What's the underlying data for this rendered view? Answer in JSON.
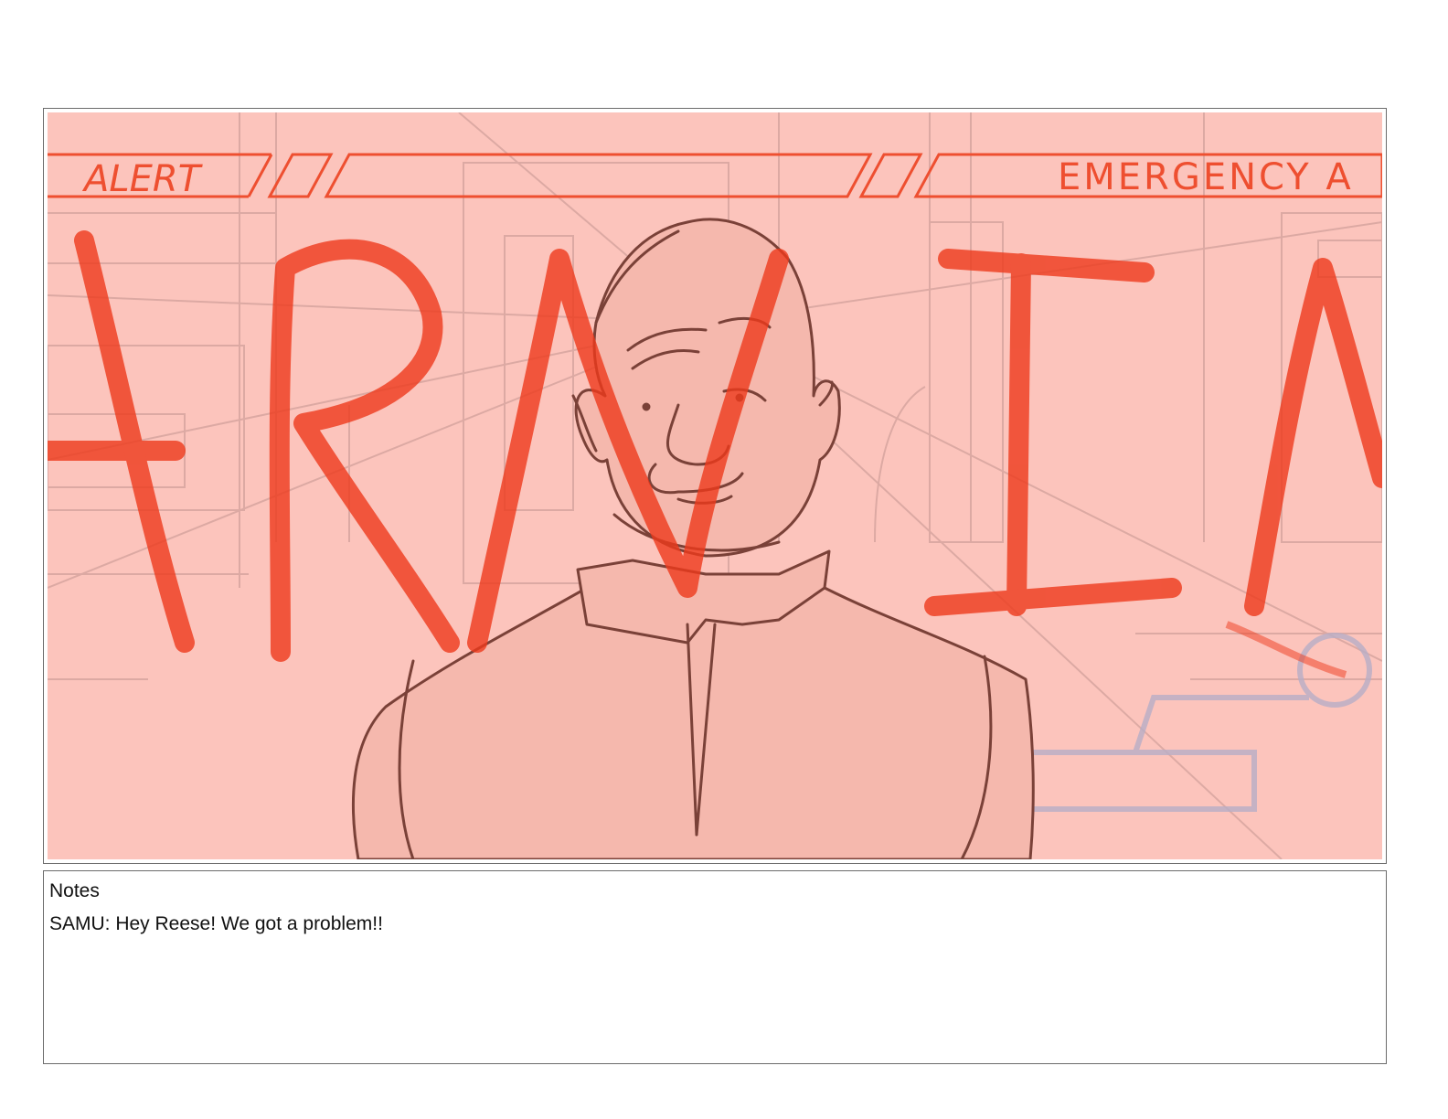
{
  "panel": {
    "banner_left": "ALERT",
    "banner_right": "EMERGENCY A",
    "background_color": "#fcc4bc",
    "accent_color": "#ee4f30"
  },
  "notes": {
    "label": "Notes",
    "text": "SAMU: Hey Reese! We got a problem!!"
  }
}
